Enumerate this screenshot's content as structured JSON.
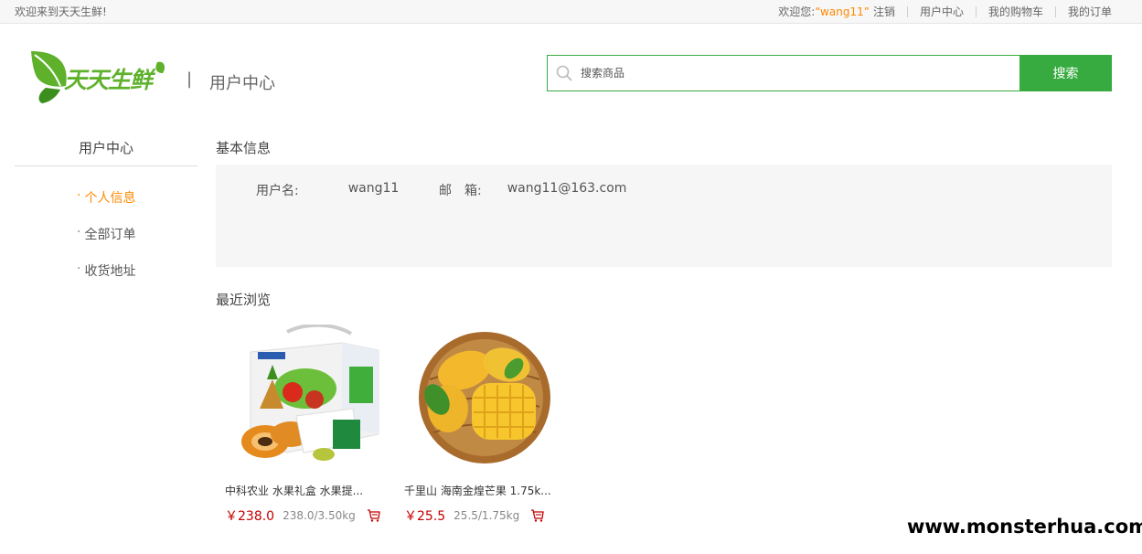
{
  "topbar": {
    "welcome": "欢迎来到天天生鲜!",
    "greeting": "欢迎您:",
    "username": "“wang11”",
    "logout": "注销",
    "user_center": "用户中心",
    "cart": "我的购物车",
    "orders": "我的订单"
  },
  "header": {
    "logo_text": "天天生鲜",
    "separator": "|",
    "title": "用户中心"
  },
  "search": {
    "placeholder": "搜索商品",
    "button": "搜索"
  },
  "menu": {
    "title": "用户中心",
    "items": [
      {
        "label": "个人信息",
        "active": true
      },
      {
        "label": "全部订单",
        "active": false
      },
      {
        "label": "收货地址",
        "active": false
      }
    ]
  },
  "basic_info": {
    "title": "基本信息",
    "username_label": "用户名:",
    "username_value": "wang11",
    "email_label": "邮　箱:",
    "email_value": "wang11@163.com"
  },
  "recent": {
    "title": "最近浏览",
    "items": [
      {
        "name": "中科农业 水果礼盒 水果提...",
        "price": "￥238.0",
        "unit": "238.0/3.50kg",
        "image": "fruit-gift-box"
      },
      {
        "name": "千里山 海南金煌芒果 1.75k...",
        "price": "￥25.5",
        "unit": "25.5/1.75kg",
        "image": "mango-basket"
      }
    ]
  },
  "watermark": "www.monsterhua.com",
  "colors": {
    "brand_green": "#37ab40",
    "accent_orange": "#ff8800",
    "price_red": "#c40000"
  }
}
